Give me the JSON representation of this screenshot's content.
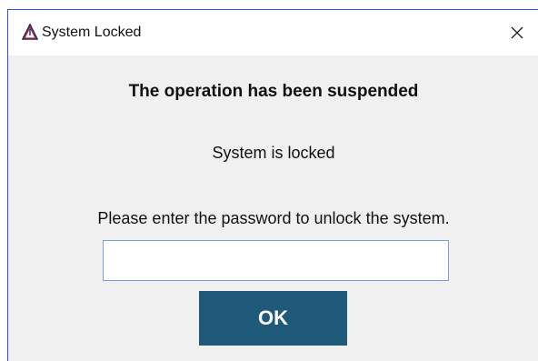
{
  "window": {
    "title": "System Locked",
    "app_icon": "warning-triangle-icon",
    "close_icon": "close-icon"
  },
  "dialog": {
    "heading": "The operation has been suspended",
    "status": "System is locked",
    "prompt": "Please enter the password to unlock the system.",
    "password_value": "",
    "ok_label": "OK"
  },
  "colors": {
    "window_border": "#2b56c6",
    "ok_button": "#1f5a7a",
    "input_border": "#7a9ed8",
    "dialog_background": "#f0f0f0"
  }
}
